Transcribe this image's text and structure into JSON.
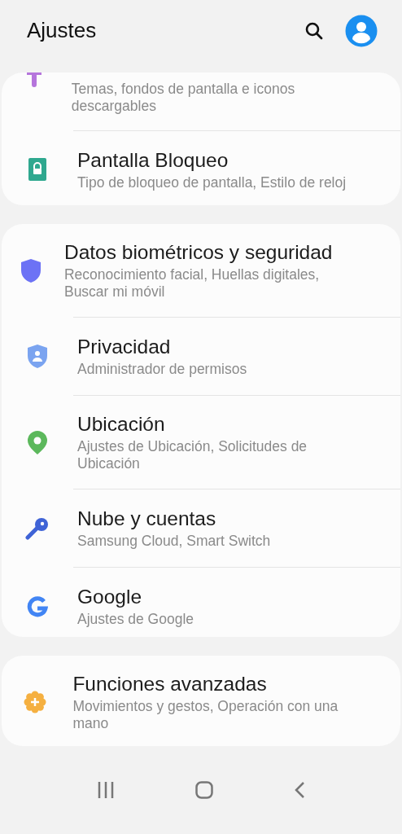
{
  "header": {
    "title": "Ajustes"
  },
  "groups": [
    {
      "items": [
        {
          "kind": "brush",
          "subtitle": "Temas, fondos de pantalla e iconos descargables"
        },
        {
          "kind": "lock",
          "title": "Pantalla Bloqueo",
          "subtitle": "Tipo de bloqueo de pantalla, Estilo de reloj"
        }
      ]
    },
    {
      "items": [
        {
          "kind": "shield",
          "title": "Datos biométricos y seguridad",
          "subtitle": "Reconocimiento facial, Huellas digitales, Buscar mi móvil"
        },
        {
          "kind": "privacy",
          "title": "Privacidad",
          "subtitle": "Administrador de permisos"
        },
        {
          "kind": "pin",
          "title": "Ubicación",
          "subtitle": "Ajustes de Ubicación, Solicitudes de Ubicación"
        },
        {
          "kind": "key",
          "title": "Nube y cuentas",
          "subtitle": "Samsung Cloud, Smart Switch"
        },
        {
          "kind": "g",
          "title": "Google",
          "subtitle": "Ajustes de Google"
        }
      ]
    },
    {
      "items": [
        {
          "kind": "gear",
          "title": "Funciones avanzadas",
          "subtitle": "Movimientos y gestos, Operación con una mano"
        }
      ]
    }
  ]
}
